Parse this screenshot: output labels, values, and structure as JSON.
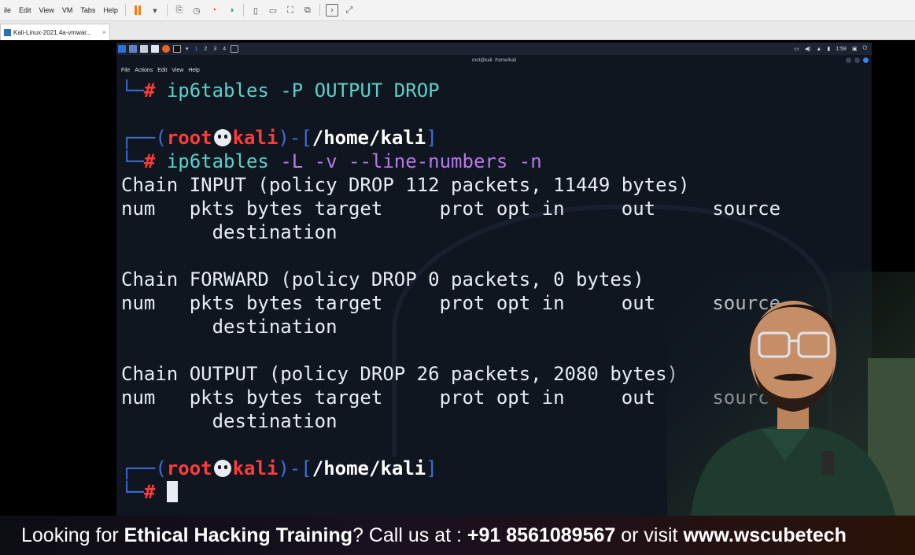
{
  "vmware": {
    "menu": [
      "ile",
      "Edit",
      "View",
      "VM",
      "Tabs",
      "Help"
    ],
    "tab_label": "Kali-Linux-2021.4a-vmwar...",
    "tab_close": "×"
  },
  "kali_panel": {
    "workspaces": [
      "1",
      "2",
      "3",
      "4"
    ],
    "clock": "1:58"
  },
  "terminal": {
    "title": "root@kali: /home/kali",
    "menu": [
      "File",
      "Actions",
      "Edit",
      "View",
      "Help"
    ],
    "prev_cmd": "ip6tables -P OUTPUT DROP",
    "prompt": {
      "user": "root",
      "host": "kali",
      "path": "/home/kali"
    },
    "cmd_name": "ip6tables",
    "cmd_args": "-L -v --line-numbers -n",
    "output": [
      "Chain INPUT (policy DROP 112 packets, 11449 bytes)",
      "num   pkts bytes target     prot opt in     out     source",
      "        destination",
      "",
      "Chain FORWARD (policy DROP 0 packets, 0 bytes)",
      "num   pkts bytes target     prot opt in     out     source",
      "        destination",
      "",
      "Chain OUTPUT (policy DROP 26 packets, 2080 bytes)",
      "num   pkts bytes target     prot opt in     out     source",
      "        destination"
    ]
  },
  "banner": {
    "pre": "Looking for ",
    "bold1": "Ethical Hacking Training",
    "mid": "? Call us at : ",
    "bold2": "+91 8561089567",
    "mid2": " or visit ",
    "bold3": "www.wscubetech"
  }
}
